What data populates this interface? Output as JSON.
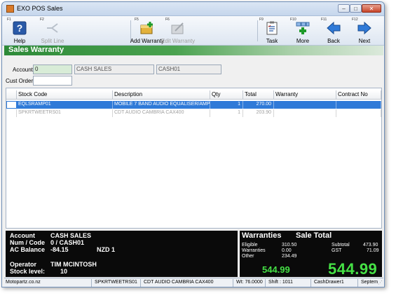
{
  "window": {
    "title": "EXO POS Sales",
    "buttons": {
      "minimize": "–",
      "maximize": "□",
      "close": "✕"
    }
  },
  "toolbar": {
    "help": {
      "fkey": "F1",
      "label": "Help",
      "icon": "help-icon"
    },
    "split": {
      "fkey": "F2",
      "label": "Split Line",
      "icon": "split-line-icon"
    },
    "addwarranty": {
      "fkey": "F5",
      "label": "Add Warranty",
      "icon": "add-warranty-icon"
    },
    "editwarranty": {
      "fkey": "F6",
      "label": "Edit Warranty",
      "icon": "edit-warranty-icon"
    },
    "task": {
      "fkey": "F9",
      "label": "Task",
      "icon": "task-icon"
    },
    "more": {
      "fkey": "F10",
      "label": "More",
      "icon": "more-icon"
    },
    "back": {
      "fkey": "F11",
      "label": "Back",
      "icon": "back-arrow-icon"
    },
    "next": {
      "fkey": "F12",
      "label": "Next",
      "icon": "next-arrow-icon"
    }
  },
  "section": {
    "title": "Sales Warranty"
  },
  "form": {
    "account_label": "Account",
    "account_code": "0",
    "account_name": "CASH SALES",
    "account_ref": "CASH01",
    "cust_order_label": "Cust Order",
    "cust_order_value": ""
  },
  "grid": {
    "columns": [
      "Stock Code",
      "Description",
      "Qty",
      "Total",
      "Warranty",
      "Contract No"
    ],
    "rows": [
      {
        "stock_code": "EQLSRAMP01",
        "description": "MOBILE 7 BAND AUDIO EQUALISER/AMP",
        "qty": "1",
        "total": "270.00",
        "warranty": "",
        "contract": ""
      },
      {
        "stock_code": "SPKRTWEETRS01",
        "description": "CDT AUDIO CAMBRIA CAX400",
        "qty": "1",
        "total": "203.90",
        "warranty": "",
        "contract": ""
      }
    ]
  },
  "info": {
    "account_label": "Account",
    "account_value": "CASH SALES",
    "num_code_label": "Num / Code",
    "num_code_value": "0 / CASH01",
    "balance_label": "AC Balance",
    "balance_value": "-84.15",
    "currency": "NZD 1",
    "operator_label": "Operator",
    "operator_value": "TIM MCINTOSH",
    "stock_label": "Stock level:",
    "stock_value": "10"
  },
  "totals": {
    "warranties_header": "Warranties",
    "sale_total_header": "Sale Total",
    "eligible_label": "Eligible",
    "eligible_value": "310.50",
    "warranties_label": "Warranties",
    "warranties_value": "0.00",
    "other_label": "Other",
    "other_value": "234.49",
    "subtotal_label": "Subtotal",
    "subtotal_value": "473.90",
    "gst_label": "GST",
    "gst_value": "71.09",
    "warranty_total": "544.99",
    "sale_total": "544.99"
  },
  "statusbar": {
    "site": "Motopartz.co.nz",
    "stock_code": "SPKRTWEETRS01",
    "description": "CDT AUDIO CAMBRIA CAX400",
    "weight": "Wt: 76.0000",
    "shift": "Shift : 1011",
    "drawer": "CashDrawer1",
    "date": "Septem"
  },
  "colors": {
    "section_green": "#2d8a38",
    "selection_blue": "#2f7ad8",
    "total_green": "#45e045"
  }
}
